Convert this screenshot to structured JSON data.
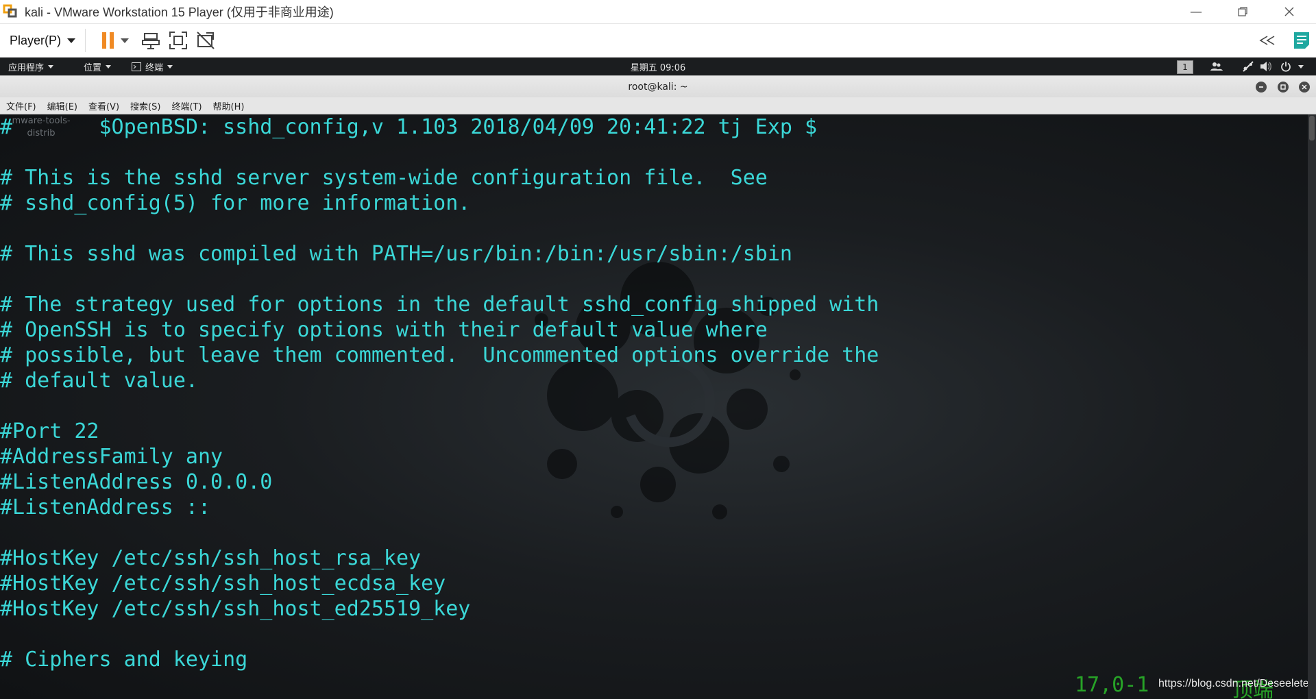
{
  "window": {
    "title": "kali - VMware Workstation 15 Player (仅用于非商业用途)"
  },
  "toolbar": {
    "player_menu": "Player(P)"
  },
  "gnome_bar": {
    "apps_menu": "应用程序",
    "places_menu": "位置",
    "terminal_menu": "终端",
    "clock": "星期五 09:06",
    "workspace": "1"
  },
  "terminal": {
    "title": "root@kali: ~",
    "menu": [
      "文件(F)",
      "编辑(E)",
      "查看(V)",
      "搜索(S)",
      "终端(T)",
      "帮助(H)"
    ],
    "desktop_icon_label_1": "mware-tools-",
    "desktop_icon_label_2": "distrib",
    "lines": [
      "#\t$OpenBSD: sshd_config,v 1.103 2018/04/09 20:41:22 tj Exp $",
      "",
      "# This is the sshd server system-wide configuration file.  See",
      "# sshd_config(5) for more information.",
      "",
      "# This sshd was compiled with PATH=/usr/bin:/bin:/usr/sbin:/sbin",
      "",
      "# The strategy used for options in the default sshd_config shipped with",
      "# OpenSSH is to specify options with their default value where",
      "# possible, but leave them commented.  Uncommented options override the",
      "# default value.",
      "",
      "#Port 22",
      "#AddressFamily any",
      "#ListenAddress 0.0.0.0",
      "#ListenAddress ::",
      "",
      "#HostKey /etc/ssh/ssh_host_rsa_key",
      "#HostKey /etc/ssh/ssh_host_ecdsa_key",
      "#HostKey /etc/ssh/ssh_host_ed25519_key",
      "",
      "# Ciphers and keying"
    ],
    "status_position": "17,0-1",
    "status_scroll": "顶端",
    "watermark": "https://blog.csdn.net/Deseelete"
  },
  "colors": {
    "terminal_text": "#3bd7d7",
    "status_text": "#27a327",
    "pause_orange": "#f08a24",
    "note_teal": "#1fa8a0"
  },
  "icons": [
    "vmware-logo-icon",
    "minimize-icon",
    "restore-icon",
    "close-icon",
    "pause-icon",
    "send-ctrl-alt-del-icon",
    "fullscreen-icon",
    "unity-icon",
    "collapse-toolbar-icon",
    "notes-icon",
    "terminal-icon",
    "users-icon",
    "network-icon",
    "volume-icon",
    "power-icon"
  ]
}
